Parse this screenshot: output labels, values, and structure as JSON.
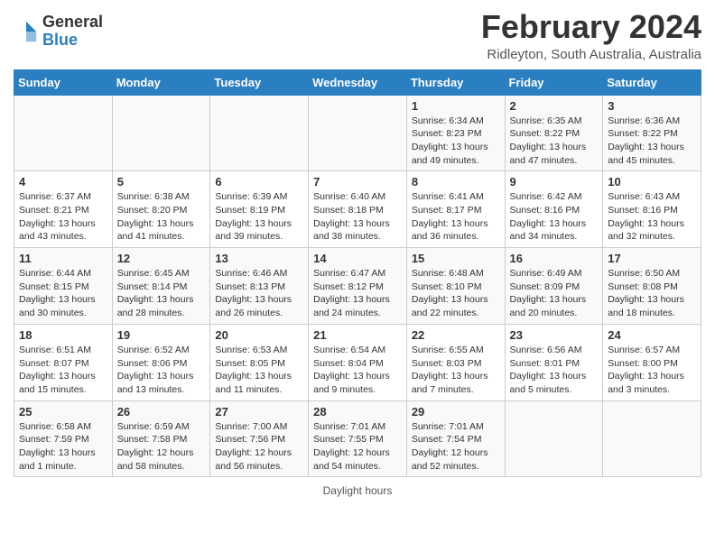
{
  "logo": {
    "general": "General",
    "blue": "Blue"
  },
  "title": "February 2024",
  "subtitle": "Ridleyton, South Australia, Australia",
  "days_of_week": [
    "Sunday",
    "Monday",
    "Tuesday",
    "Wednesday",
    "Thursday",
    "Friday",
    "Saturday"
  ],
  "weeks": [
    [
      {
        "day": "",
        "info": ""
      },
      {
        "day": "",
        "info": ""
      },
      {
        "day": "",
        "info": ""
      },
      {
        "day": "",
        "info": ""
      },
      {
        "day": "1",
        "info": "Sunrise: 6:34 AM\nSunset: 8:23 PM\nDaylight: 13 hours\nand 49 minutes."
      },
      {
        "day": "2",
        "info": "Sunrise: 6:35 AM\nSunset: 8:22 PM\nDaylight: 13 hours\nand 47 minutes."
      },
      {
        "day": "3",
        "info": "Sunrise: 6:36 AM\nSunset: 8:22 PM\nDaylight: 13 hours\nand 45 minutes."
      }
    ],
    [
      {
        "day": "4",
        "info": "Sunrise: 6:37 AM\nSunset: 8:21 PM\nDaylight: 13 hours\nand 43 minutes."
      },
      {
        "day": "5",
        "info": "Sunrise: 6:38 AM\nSunset: 8:20 PM\nDaylight: 13 hours\nand 41 minutes."
      },
      {
        "day": "6",
        "info": "Sunrise: 6:39 AM\nSunset: 8:19 PM\nDaylight: 13 hours\nand 39 minutes."
      },
      {
        "day": "7",
        "info": "Sunrise: 6:40 AM\nSunset: 8:18 PM\nDaylight: 13 hours\nand 38 minutes."
      },
      {
        "day": "8",
        "info": "Sunrise: 6:41 AM\nSunset: 8:17 PM\nDaylight: 13 hours\nand 36 minutes."
      },
      {
        "day": "9",
        "info": "Sunrise: 6:42 AM\nSunset: 8:16 PM\nDaylight: 13 hours\nand 34 minutes."
      },
      {
        "day": "10",
        "info": "Sunrise: 6:43 AM\nSunset: 8:16 PM\nDaylight: 13 hours\nand 32 minutes."
      }
    ],
    [
      {
        "day": "11",
        "info": "Sunrise: 6:44 AM\nSunset: 8:15 PM\nDaylight: 13 hours\nand 30 minutes."
      },
      {
        "day": "12",
        "info": "Sunrise: 6:45 AM\nSunset: 8:14 PM\nDaylight: 13 hours\nand 28 minutes."
      },
      {
        "day": "13",
        "info": "Sunrise: 6:46 AM\nSunset: 8:13 PM\nDaylight: 13 hours\nand 26 minutes."
      },
      {
        "day": "14",
        "info": "Sunrise: 6:47 AM\nSunset: 8:12 PM\nDaylight: 13 hours\nand 24 minutes."
      },
      {
        "day": "15",
        "info": "Sunrise: 6:48 AM\nSunset: 8:10 PM\nDaylight: 13 hours\nand 22 minutes."
      },
      {
        "day": "16",
        "info": "Sunrise: 6:49 AM\nSunset: 8:09 PM\nDaylight: 13 hours\nand 20 minutes."
      },
      {
        "day": "17",
        "info": "Sunrise: 6:50 AM\nSunset: 8:08 PM\nDaylight: 13 hours\nand 18 minutes."
      }
    ],
    [
      {
        "day": "18",
        "info": "Sunrise: 6:51 AM\nSunset: 8:07 PM\nDaylight: 13 hours\nand 15 minutes."
      },
      {
        "day": "19",
        "info": "Sunrise: 6:52 AM\nSunset: 8:06 PM\nDaylight: 13 hours\nand 13 minutes."
      },
      {
        "day": "20",
        "info": "Sunrise: 6:53 AM\nSunset: 8:05 PM\nDaylight: 13 hours\nand 11 minutes."
      },
      {
        "day": "21",
        "info": "Sunrise: 6:54 AM\nSunset: 8:04 PM\nDaylight: 13 hours\nand 9 minutes."
      },
      {
        "day": "22",
        "info": "Sunrise: 6:55 AM\nSunset: 8:03 PM\nDaylight: 13 hours\nand 7 minutes."
      },
      {
        "day": "23",
        "info": "Sunrise: 6:56 AM\nSunset: 8:01 PM\nDaylight: 13 hours\nand 5 minutes."
      },
      {
        "day": "24",
        "info": "Sunrise: 6:57 AM\nSunset: 8:00 PM\nDaylight: 13 hours\nand 3 minutes."
      }
    ],
    [
      {
        "day": "25",
        "info": "Sunrise: 6:58 AM\nSunset: 7:59 PM\nDaylight: 13 hours\nand 1 minute."
      },
      {
        "day": "26",
        "info": "Sunrise: 6:59 AM\nSunset: 7:58 PM\nDaylight: 12 hours\nand 58 minutes."
      },
      {
        "day": "27",
        "info": "Sunrise: 7:00 AM\nSunset: 7:56 PM\nDaylight: 12 hours\nand 56 minutes."
      },
      {
        "day": "28",
        "info": "Sunrise: 7:01 AM\nSunset: 7:55 PM\nDaylight: 12 hours\nand 54 minutes."
      },
      {
        "day": "29",
        "info": "Sunrise: 7:01 AM\nSunset: 7:54 PM\nDaylight: 12 hours\nand 52 minutes."
      },
      {
        "day": "",
        "info": ""
      },
      {
        "day": "",
        "info": ""
      }
    ]
  ],
  "footer": "Daylight hours"
}
